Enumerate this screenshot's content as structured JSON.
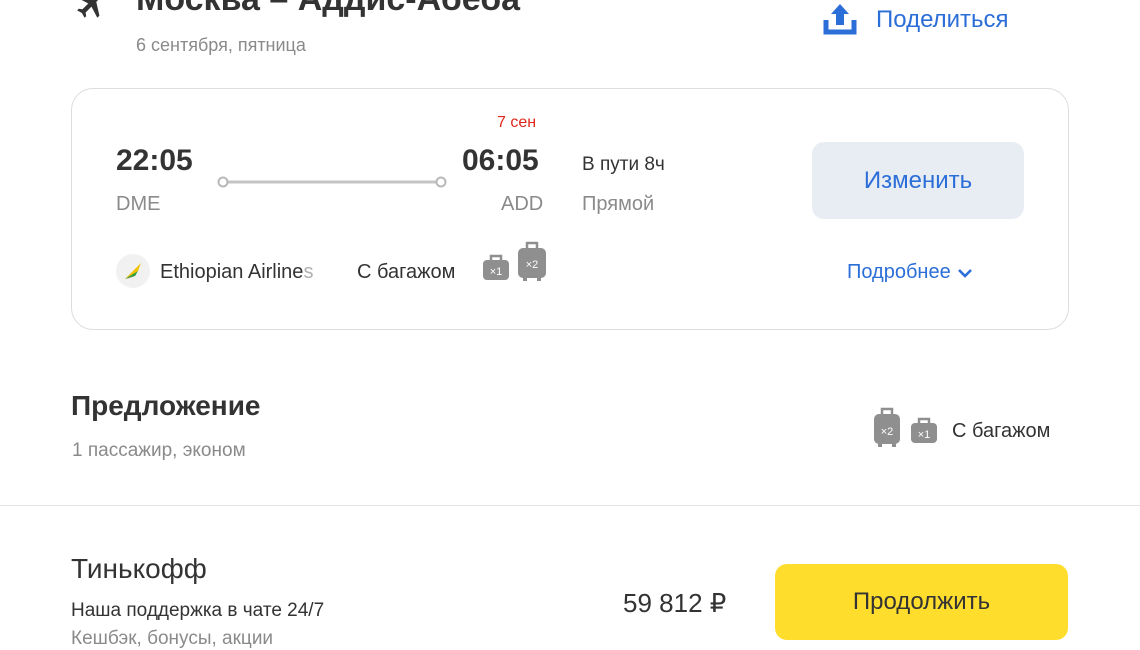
{
  "header": {
    "title": "Москва – Аддис-Абеба",
    "date": "6 сентября, пятница",
    "share_label": "Поделиться"
  },
  "flight": {
    "arrival_date_badge": "7 сен",
    "departure_time": "22:05",
    "arrival_time": "06:05",
    "departure_code": "DME",
    "arrival_code": "ADD",
    "duration": "В пути 8ч",
    "stops": "Прямой",
    "change_label": "Изменить",
    "airline_name_visible": "Ethiopian Airline",
    "airline_name_faded": "s",
    "baggage_label": "С багажом",
    "bag_small_count": "×1",
    "bag_suitcase_count": "×2",
    "details_label": "Подробнее"
  },
  "offer": {
    "title": "Предложение",
    "subtitle": "1 пассажир, эконом",
    "suitcase_count": "×2",
    "bag_count": "×1",
    "baggage_label": "С багажом"
  },
  "vendor": {
    "name": "Тинькофф",
    "feature_1": "Наша поддержка в чате 24/7",
    "feature_2": "Кешбэк, бонусы, акции",
    "price": "59 812 ₽",
    "continue_label": "Продолжить"
  },
  "colors": {
    "accent_blue": "#2b6ed8",
    "date_badge_red": "#e0271b",
    "continue_yellow": "#ffdd2d",
    "change_bg": "#e8edf3"
  },
  "icons": {
    "plane": "plane-icon",
    "share": "share-upload-icon",
    "chevron": "chevron-down-icon",
    "bag": "hand-bag-icon",
    "suitcase": "suitcase-icon",
    "airline_logo": "ethiopian-airlines-logo"
  }
}
